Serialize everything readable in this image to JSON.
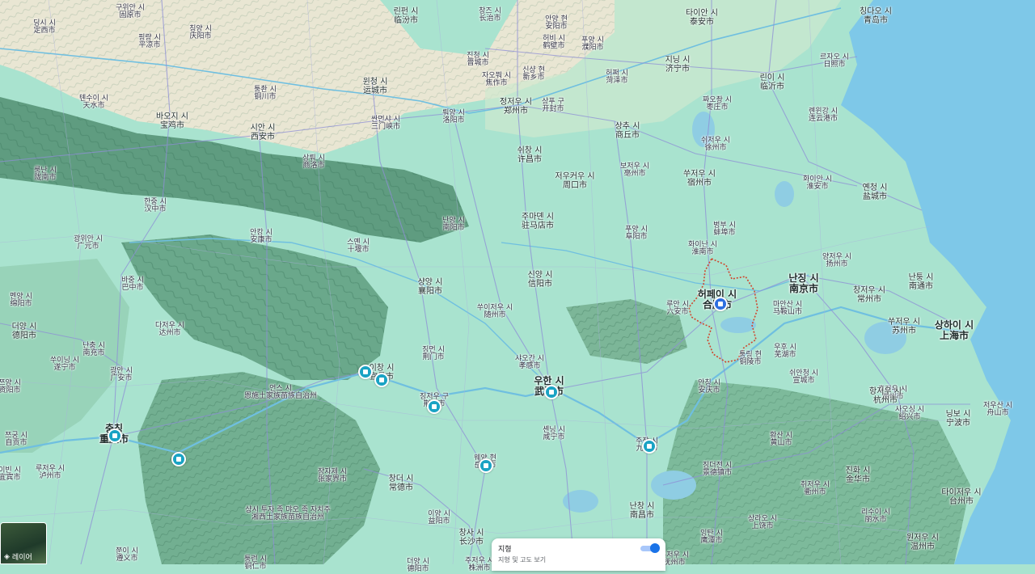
{
  "map": {
    "colors": {
      "lowland": "#a9e3cf",
      "mountain": "#5c9a7d",
      "plain": "#e6e3cf",
      "sea": "#7ec8e8",
      "lake": "#8fcde3",
      "boundary": "#d0452c"
    },
    "cities": [
      {
        "id": "dingxi",
        "ko": "딩시 시",
        "zh": "定西市",
        "tier": "minor"
      },
      {
        "id": "guyuan",
        "ko": "구위안 시",
        "zh": "固原市",
        "tier": "minor"
      },
      {
        "id": "pingliang",
        "ko": "핑량 시",
        "zh": "平凉市",
        "tier": "minor"
      },
      {
        "id": "qingyang",
        "ko": "칭양 시",
        "zh": "庆阳市",
        "tier": "minor"
      },
      {
        "id": "linfen",
        "ko": "린펀 시",
        "zh": "临汾市",
        "tier": "normal"
      },
      {
        "id": "changzhi",
        "ko": "창즈 시",
        "zh": "长治市",
        "tier": "minor"
      },
      {
        "id": "anyang",
        "ko": "안양 현",
        "zh": "安阳市",
        "tier": "minor"
      },
      {
        "id": "taian",
        "ko": "타이안 시",
        "zh": "泰安市",
        "tier": "normal"
      },
      {
        "id": "qingdao",
        "ko": "칭다오 시",
        "zh": "青岛市",
        "tier": "normal"
      },
      {
        "id": "hebi",
        "ko": "허비 시",
        "zh": "鹤壁市",
        "tier": "minor"
      },
      {
        "id": "puyang",
        "ko": "푸양 시",
        "zh": "濮阳市",
        "tier": "minor"
      },
      {
        "id": "jincheng",
        "ko": "진청 시",
        "zh": "晋城市",
        "tier": "minor"
      },
      {
        "id": "jining",
        "ko": "지닝 시",
        "zh": "济宁市",
        "tier": "normal"
      },
      {
        "id": "rizhao",
        "ko": "르자오 시",
        "zh": "日照市",
        "tier": "minor"
      },
      {
        "id": "jiaozuo",
        "ko": "자오쭤 시",
        "zh": "焦作市",
        "tier": "minor"
      },
      {
        "id": "xinxiang",
        "ko": "신샹 현",
        "zh": "新乡市",
        "tier": "minor"
      },
      {
        "id": "heze",
        "ko": "허쩌 시",
        "zh": "菏泽市",
        "tier": "minor"
      },
      {
        "id": "linyi",
        "ko": "린이 시",
        "zh": "临沂市",
        "tier": "normal"
      },
      {
        "id": "tianshui",
        "ko": "톈수이 시",
        "zh": "天水市",
        "tier": "minor"
      },
      {
        "id": "tongchuan",
        "ko": "퉁촨 시",
        "zh": "铜川市",
        "tier": "minor"
      },
      {
        "id": "yuncheng",
        "ko": "윈청 시",
        "zh": "运城市",
        "tier": "normal"
      },
      {
        "id": "zhengzhou",
        "ko": "정저우 시",
        "zh": "郑州市",
        "tier": "normal"
      },
      {
        "id": "kaifeng",
        "ko": "상푸 구",
        "zh": "开封市",
        "tier": "minor"
      },
      {
        "id": "zaozhuang",
        "ko": "짜오좡 시",
        "zh": "枣庄市",
        "tier": "minor"
      },
      {
        "id": "baoji",
        "ko": "바오지 시",
        "zh": "宝鸡市",
        "tier": "normal"
      },
      {
        "id": "sanmenxia",
        "ko": "싼먼샤 시",
        "zh": "三门峡市",
        "tier": "minor"
      },
      {
        "id": "luoyang",
        "ko": "뤄양 시",
        "zh": "洛阳市",
        "tier": "minor"
      },
      {
        "id": "shangqiu",
        "ko": "상추 시",
        "zh": "商丘市",
        "tier": "normal"
      },
      {
        "id": "lianyungang",
        "ko": "롄윈강 시",
        "zh": "连云港市",
        "tier": "minor"
      },
      {
        "id": "xian",
        "ko": "시안 시",
        "zh": "西安市",
        "tier": "normal"
      },
      {
        "id": "xuzhou",
        "ko": "쉬저우 시",
        "zh": "徐州市",
        "tier": "minor"
      },
      {
        "id": "xuchang",
        "ko": "쉬창 시",
        "zh": "许昌市",
        "tier": "normal"
      },
      {
        "id": "shangluo",
        "ko": "상뤄 시",
        "zh": "商洛市",
        "tier": "minor"
      },
      {
        "id": "longnan",
        "ko": "룽난 시",
        "zh": "陇南市",
        "tier": "minor"
      },
      {
        "id": "zhoukou",
        "ko": "저우커우 시",
        "zh": "周口市",
        "tier": "normal"
      },
      {
        "id": "bozhou",
        "ko": "보저우 시",
        "zh": "亳州市",
        "tier": "minor"
      },
      {
        "id": "suzhou_ah",
        "ko": "쑤저우 시",
        "zh": "宿州市",
        "tier": "normal"
      },
      {
        "id": "huaian",
        "ko": "화이안 시",
        "zh": "淮安市",
        "tier": "minor"
      },
      {
        "id": "yancheng",
        "ko": "옌청 시",
        "zh": "盐城市",
        "tier": "normal"
      },
      {
        "id": "hanzhong",
        "ko": "한중 시",
        "zh": "汉中市",
        "tier": "minor"
      },
      {
        "id": "nanyang",
        "ko": "난양 시",
        "zh": "南阳市",
        "tier": "minor"
      },
      {
        "id": "zhumadian",
        "ko": "주마뎬 시",
        "zh": "驻马店市",
        "tier": "normal"
      },
      {
        "id": "fuyang",
        "ko": "푸양 시",
        "zh": "阜阳市",
        "tier": "minor"
      },
      {
        "id": "bengbu",
        "ko": "벙부 시",
        "zh": "蚌埠市",
        "tier": "minor"
      },
      {
        "id": "guangyuan",
        "ko": "광위안 시",
        "zh": "广元市",
        "tier": "minor"
      },
      {
        "id": "ankang",
        "ko": "안캉 시",
        "zh": "安康市",
        "tier": "minor"
      },
      {
        "id": "shiyan",
        "ko": "스옌 시",
        "zh": "十堰市",
        "tier": "minor"
      },
      {
        "id": "huainan",
        "ko": "화이난 시",
        "zh": "淮南市",
        "tier": "minor"
      },
      {
        "id": "yangzhou",
        "ko": "양저우 시",
        "zh": "扬州市",
        "tier": "minor"
      },
      {
        "id": "xiangyang",
        "ko": "샹양 시",
        "zh": "襄阳市",
        "tier": "normal"
      },
      {
        "id": "xinyang",
        "ko": "신양 시",
        "zh": "信阳市",
        "tier": "normal"
      },
      {
        "id": "nanjing",
        "ko": "난징 시",
        "zh": "南京市",
        "tier": "major"
      },
      {
        "id": "nantong",
        "ko": "난퉁 시",
        "zh": "南通市",
        "tier": "normal"
      },
      {
        "id": "bazhong",
        "ko": "바중 시",
        "zh": "巴中市",
        "tier": "minor"
      },
      {
        "id": "mianyang",
        "ko": "멘양 시",
        "zh": "绵阳市",
        "tier": "minor"
      },
      {
        "id": "hefei",
        "ko": "허페이 시",
        "zh": "合肥市",
        "tier": "major"
      },
      {
        "id": "changzhou",
        "ko": "창저우 시",
        "zh": "常州市",
        "tier": "normal"
      },
      {
        "id": "luan",
        "ko": "루안 시",
        "zh": "六安市",
        "tier": "minor"
      },
      {
        "id": "maanshan",
        "ko": "마안산 시",
        "zh": "马鞍山市",
        "tier": "minor"
      },
      {
        "id": "suizhou",
        "ko": "쑤이저우 시",
        "zh": "随州市",
        "tier": "minor"
      },
      {
        "id": "suzhou_js",
        "ko": "쑤저우 시",
        "zh": "苏州市",
        "tier": "normal"
      },
      {
        "id": "shanghai",
        "ko": "상하이 시",
        "zh": "上海市",
        "tier": "major"
      },
      {
        "id": "deyang",
        "ko": "더양 시",
        "zh": "德阳市",
        "tier": "normal"
      },
      {
        "id": "dazhou",
        "ko": "다저우 시",
        "zh": "达州市",
        "tier": "minor"
      },
      {
        "id": "nanchong",
        "ko": "난충 시",
        "zh": "南充市",
        "tier": "minor"
      },
      {
        "id": "jingmen",
        "ko": "징먼 시",
        "zh": "荆门市",
        "tier": "minor"
      },
      {
        "id": "wuhu",
        "ko": "우후 시",
        "zh": "芜湖市",
        "tier": "minor"
      },
      {
        "id": "tongling",
        "ko": "퉁링 현",
        "zh": "铜陵市",
        "tier": "minor"
      },
      {
        "id": "suining",
        "ko": "쑤이닝 시",
        "zh": "遂宁市",
        "tier": "minor"
      },
      {
        "id": "guangan",
        "ko": "광안 시",
        "zh": "广安市",
        "tier": "minor"
      },
      {
        "id": "xiaogan",
        "ko": "샤오간 시",
        "zh": "孝感市",
        "tier": "minor"
      },
      {
        "id": "yichang",
        "ko": "이창 시",
        "zh": "宜昌市",
        "tier": "normal"
      },
      {
        "id": "wuhan",
        "ko": "우한 시",
        "zh": "武汉市",
        "tier": "major"
      },
      {
        "id": "anqing",
        "ko": "안칭 시",
        "zh": "安庆市",
        "tier": "minor"
      },
      {
        "id": "xuancheng",
        "ko": "쉬안청 시",
        "zh": "宣城市",
        "tier": "minor"
      },
      {
        "id": "huzhou",
        "ko": "후저우 시",
        "zh": "湖州市",
        "tier": "minor"
      },
      {
        "id": "ziyang",
        "ko": "쯔양 시",
        "zh": "资阳市",
        "tier": "minor"
      },
      {
        "id": "enshi",
        "ko": "언스 시",
        "zh": "恩施土家族苗族自治州",
        "tier": "minor"
      },
      {
        "id": "jingzhou",
        "ko": "징저우 구",
        "zh": "荆州市",
        "tier": "minor"
      },
      {
        "id": "hangzhou",
        "ko": "항저우 시",
        "zh": "杭州市",
        "tier": "normal"
      },
      {
        "id": "shaoxing",
        "ko": "사오싱 시",
        "zh": "绍兴市",
        "tier": "minor"
      },
      {
        "id": "ningbo",
        "ko": "닝보 시",
        "zh": "宁波市",
        "tier": "normal"
      },
      {
        "id": "zhoushan",
        "ko": "저우산 시",
        "zh": "舟山市",
        "tier": "minor"
      },
      {
        "id": "zigong",
        "ko": "쯔궁 시",
        "zh": "自贡市",
        "tier": "minor"
      },
      {
        "id": "chongqing",
        "ko": "충칭",
        "zh": "重庆市",
        "tier": "major"
      },
      {
        "id": "xianning",
        "ko": "셴닝 시",
        "zh": "咸宁市",
        "tier": "minor"
      },
      {
        "id": "jiujiang",
        "ko": "주장 시",
        "zh": "九江市",
        "tier": "minor"
      },
      {
        "id": "huangshan",
        "ko": "황산 시",
        "zh": "黄山市",
        "tier": "minor"
      },
      {
        "id": "yibin",
        "ko": "이빈 시",
        "zh": "宜宾市",
        "tier": "minor"
      },
      {
        "id": "luzhou",
        "ko": "루저우 시",
        "zh": "泸州市",
        "tier": "minor"
      },
      {
        "id": "yueyang",
        "ko": "웨양 현",
        "zh": "岳阳市",
        "tier": "minor"
      },
      {
        "id": "jingdezhen",
        "ko": "징더전 시",
        "zh": "景德镇市",
        "tier": "minor"
      },
      {
        "id": "jinhua",
        "ko": "진화 시",
        "zh": "金华市",
        "tier": "normal"
      },
      {
        "id": "zhangjiajie",
        "ko": "장자제 시",
        "zh": "张家界市",
        "tier": "minor"
      },
      {
        "id": "changde",
        "ko": "창더 시",
        "zh": "常德市",
        "tier": "normal"
      },
      {
        "id": "quzhou",
        "ko": "취저우 시",
        "zh": "衢州市",
        "tier": "minor"
      },
      {
        "id": "taizhou",
        "ko": "타이저우 시",
        "zh": "台州市",
        "tier": "normal"
      },
      {
        "id": "xiangxi",
        "ko": "샹시 투자 족 먀오 족 자치주",
        "zh": "湘西土家族苗族自治州",
        "tier": "minor"
      },
      {
        "id": "nanchang",
        "ko": "난창 시",
        "zh": "南昌市",
        "tier": "normal"
      },
      {
        "id": "lishui",
        "ko": "리수이 시",
        "zh": "丽水市",
        "tier": "minor"
      },
      {
        "id": "yiyang",
        "ko": "이양 시",
        "zh": "益阳市",
        "tier": "minor"
      },
      {
        "id": "shangrao",
        "ko": "상라오 시",
        "zh": "上饶市",
        "tier": "minor"
      },
      {
        "id": "yingtan",
        "ko": "잉탄 시",
        "zh": "鹰潭市",
        "tier": "minor"
      },
      {
        "id": "changsha",
        "ko": "창사 시",
        "zh": "长沙市",
        "tier": "normal"
      },
      {
        "id": "wenzhou",
        "ko": "원저우 시",
        "zh": "温州市",
        "tier": "normal"
      },
      {
        "id": "zunyi",
        "ko": "쭌이 시",
        "zh": "遵义市",
        "tier": "minor"
      },
      {
        "id": "tongren",
        "ko": "퉁런 시",
        "zh": "铜仁市",
        "tier": "minor"
      },
      {
        "id": "deyang_w",
        "ko": "더양 시",
        "zh": "德阳市",
        "tier": "minor"
      },
      {
        "id": "zhuzhou",
        "ko": "주저우 시",
        "zh": "株洲市",
        "tier": "minor"
      },
      {
        "id": "fuzhou_jx",
        "ko": "푸저우 시",
        "zh": "抚州市",
        "tier": "minor"
      }
    ],
    "pins": [
      {
        "id": "pin-yichang-1"
      },
      {
        "id": "pin-yichang-2"
      },
      {
        "id": "pin-jingzhou"
      },
      {
        "id": "pin-wuhan"
      },
      {
        "id": "pin-chongqing"
      },
      {
        "id": "pin-chongqing-se"
      },
      {
        "id": "pin-yueyang"
      },
      {
        "id": "pin-jiujiang"
      },
      {
        "id": "pin-hefei",
        "selected": true
      }
    ]
  },
  "layer_button": {
    "label": "레이어",
    "icon": "layers-icon"
  },
  "terrain_card": {
    "title": "지형",
    "subtitle": "지형 및 고도 보기",
    "toggle_on": true
  }
}
